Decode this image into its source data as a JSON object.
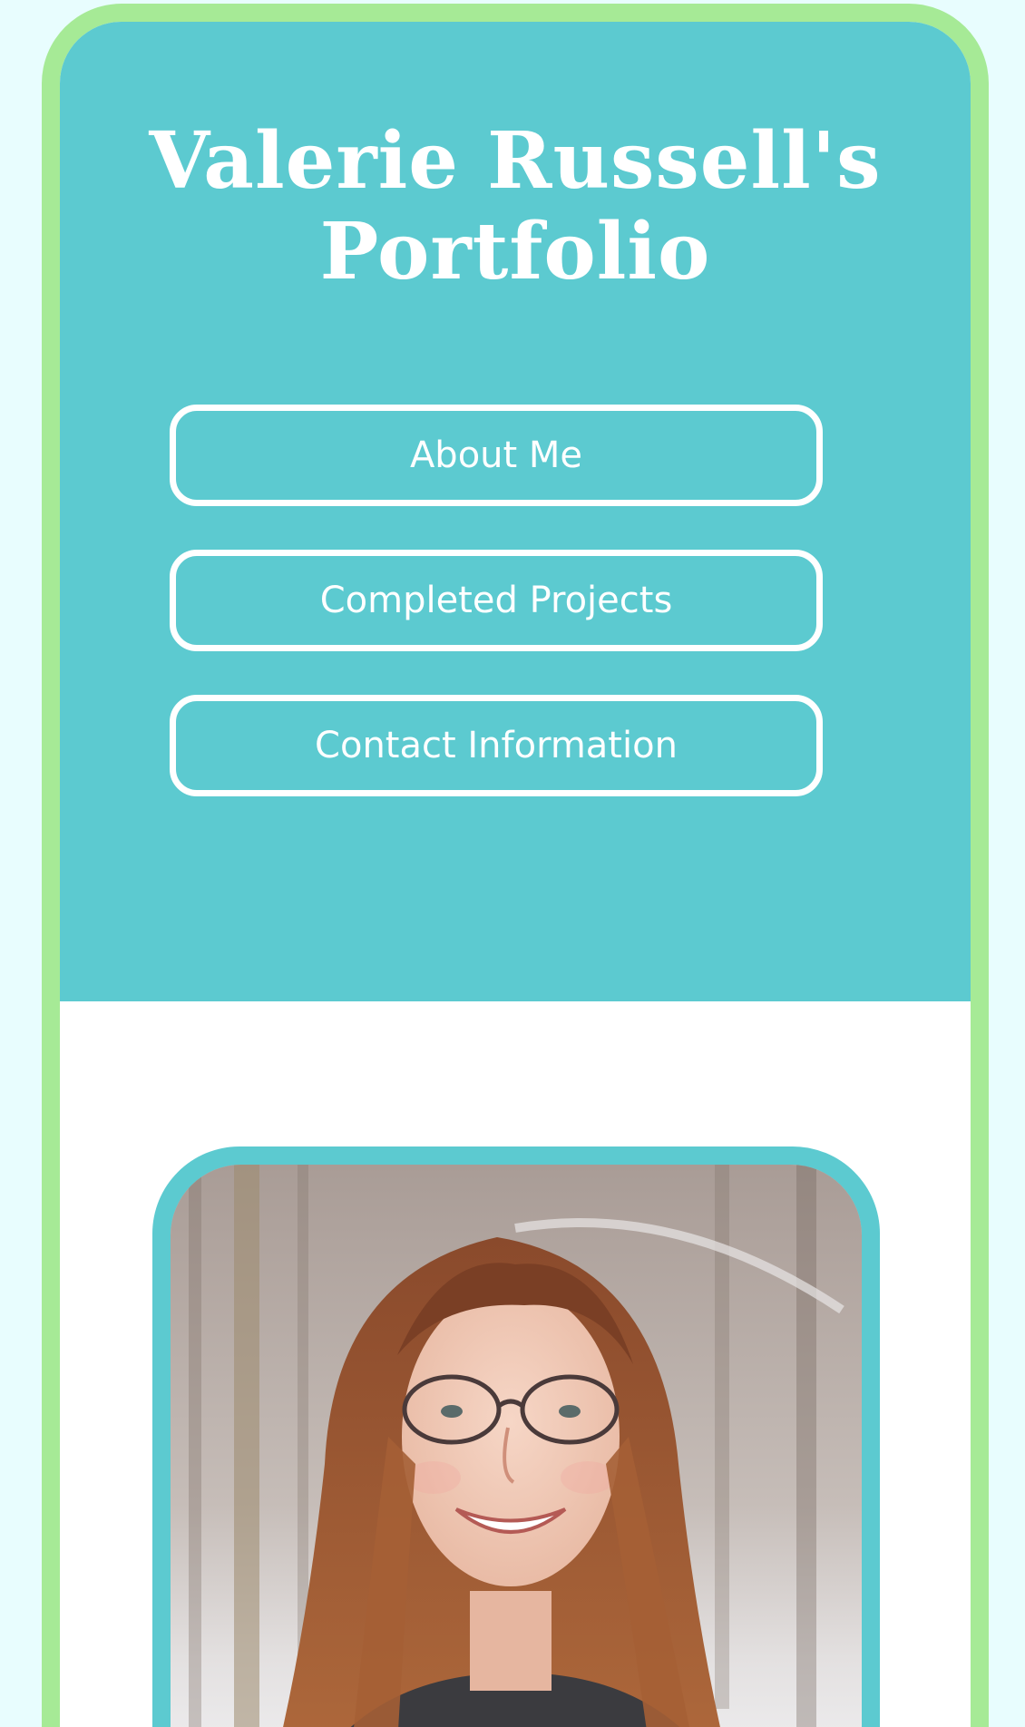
{
  "page": {
    "title": "Valerie Russell's Portfolio"
  },
  "nav": {
    "buttons": [
      {
        "label": "About Me"
      },
      {
        "label": "Completed Projects"
      },
      {
        "label": "Contact Information"
      }
    ]
  },
  "colors": {
    "background": "#e8fdfe",
    "frame_border": "#a6ea96",
    "header": "#5ccad0",
    "content": "#ffffff",
    "button_outline": "#ffffff"
  },
  "profile_photo": {
    "icon": "profile-photo",
    "description": "Portrait photo of a smiling woman with long auburn hair and glasses in a snowy forest"
  }
}
